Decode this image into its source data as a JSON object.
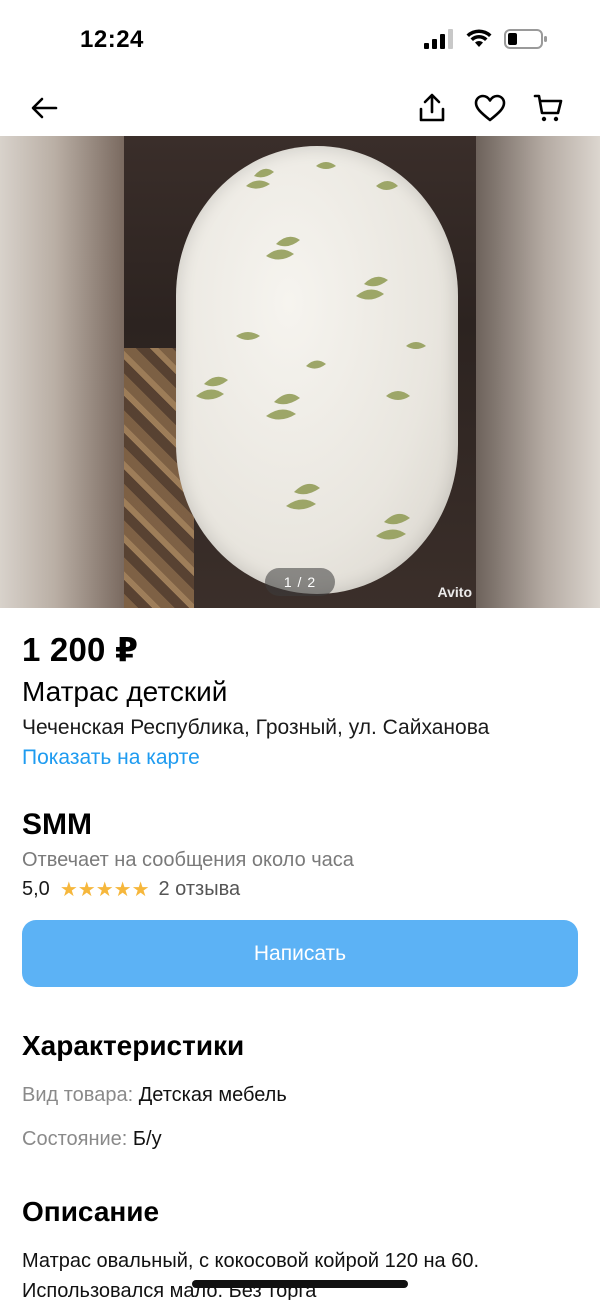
{
  "status_bar": {
    "time": "12:24"
  },
  "nav": {
    "back": "back",
    "share": "share",
    "favorite": "favorite",
    "cart": "cart"
  },
  "gallery": {
    "pager": "1 / 2",
    "watermark": "Avito"
  },
  "listing": {
    "price": "1 200 ₽",
    "title": "Матрас детский",
    "address": "Чеченская Республика, Грозный, ул. Сайханова",
    "map_link": "Показать на карте"
  },
  "seller": {
    "name": "SMM",
    "reply_time": "Отвечает на сообщения около часа",
    "rating": "5,0",
    "stars": 5,
    "reviews": "2 отзыва"
  },
  "actions": {
    "write_label": "Написать"
  },
  "specs": {
    "title": "Характеристики",
    "items": [
      {
        "key": "Вид товара:",
        "value": "Детская мебель"
      },
      {
        "key": "Состояние:",
        "value": "Б/у"
      }
    ]
  },
  "description": {
    "title": "Описание",
    "text": "Матрас овальный, с кокосовой койрой 120 на 60. Использовался мало. Без торга"
  },
  "colors": {
    "accent": "#5cb2f5",
    "link": "#1e9bf0",
    "star": "#f6b73c"
  }
}
